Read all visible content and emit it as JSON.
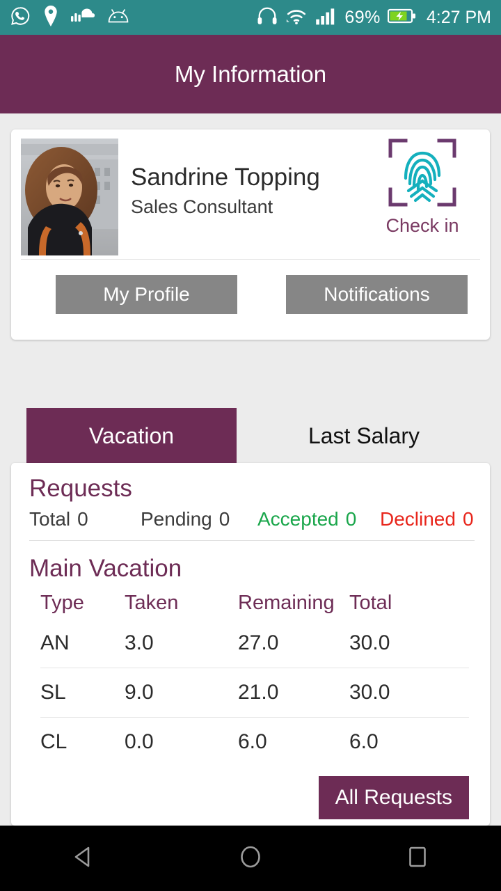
{
  "statusbar": {
    "left_icons": [
      "whatsapp-icon",
      "location-pin-icon",
      "soundcloud-icon",
      "android-icon"
    ],
    "right_icons": [
      "headphones-icon",
      "wifi-icon",
      "signal-bars-icon",
      "battery-charging-icon"
    ],
    "battery_percent": "69%",
    "time": "4:27 PM"
  },
  "appbar": {
    "title": "My Information"
  },
  "profile": {
    "name": "Sandrine Topping",
    "role": "Sales Consultant",
    "avatar_alt": "profile-photo",
    "checkin": {
      "icon": "fingerprint-scan-icon",
      "label": "Check in"
    },
    "buttons": {
      "my_profile": "My Profile",
      "notifications": "Notifications"
    }
  },
  "tabs": [
    {
      "label": "Vacation",
      "active": true
    },
    {
      "label": "Last Salary",
      "active": false
    }
  ],
  "requests": {
    "title": "Requests",
    "stats": [
      {
        "label": "Total",
        "value": "0"
      },
      {
        "label": "Pending",
        "value": "0"
      },
      {
        "label": "Accepted",
        "value": "0"
      },
      {
        "label": "Declined",
        "value": "0"
      }
    ]
  },
  "main_vacation": {
    "title": "Main Vacation",
    "columns": [
      "Type",
      "Taken",
      "Remaining",
      "Total"
    ],
    "rows": [
      {
        "type": "AN",
        "taken": "3.0",
        "remaining": "27.0",
        "total": "30.0"
      },
      {
        "type": "SL",
        "taken": "9.0",
        "remaining": "21.0",
        "total": "30.0"
      },
      {
        "type": "CL",
        "taken": "0.0",
        "remaining": "6.0",
        "total": "6.0"
      }
    ],
    "all_requests_button": "All Requests"
  },
  "navbar": {
    "back": "back-button",
    "home": "home-button",
    "recents": "recents-button"
  },
  "colors": {
    "statusbar_bg": "#2d8a8a",
    "appbar_bg": "#6d2c55",
    "accent_purple": "#6d2c55",
    "page_bg": "#ececec",
    "button_gray": "#868686",
    "accepted_green": "#1aa64b",
    "declined_red": "#e8261c",
    "fingerprint_teal": "#14b0bd"
  }
}
